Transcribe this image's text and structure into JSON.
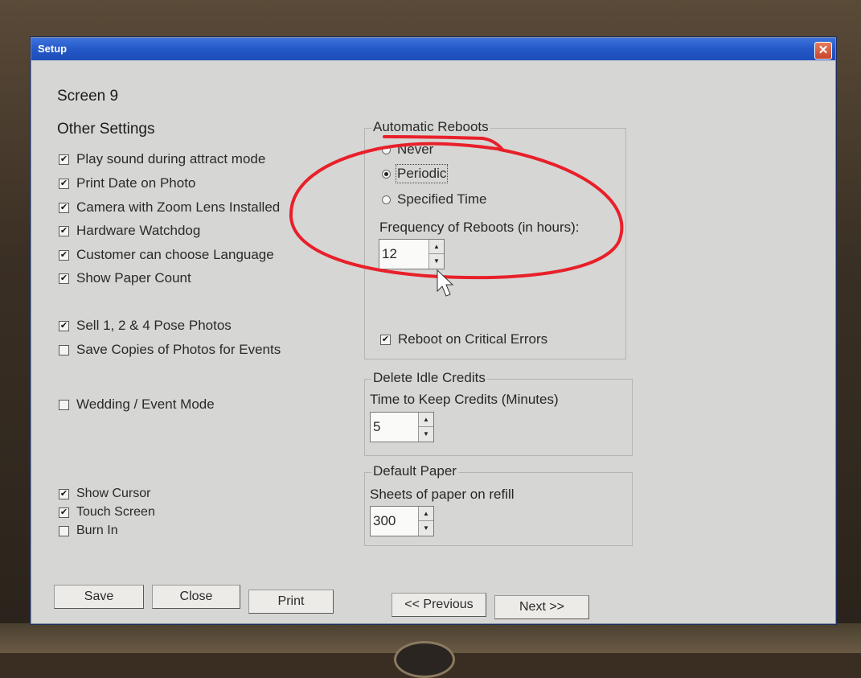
{
  "window": {
    "title": "Setup",
    "close_glyph": "✕"
  },
  "screen_label": "Screen 9",
  "other_settings": {
    "heading": "Other Settings",
    "items": [
      {
        "label": "Play sound during attract mode",
        "checked": true
      },
      {
        "label": "Print Date on Photo",
        "checked": true
      },
      {
        "label": "Camera with Zoom Lens Installed",
        "checked": true
      },
      {
        "label": "Hardware Watchdog",
        "checked": true
      },
      {
        "label": "Customer can choose Language",
        "checked": true
      },
      {
        "label": "Show Paper Count",
        "checked": true
      }
    ],
    "pose_items": [
      {
        "label": "Sell 1, 2 & 4 Pose Photos",
        "checked": true
      },
      {
        "label": "Save Copies of Photos for Events",
        "checked": false
      }
    ],
    "wedding": {
      "label": "Wedding / Event Mode",
      "checked": false
    },
    "bottom_items": [
      {
        "label": "Show Cursor",
        "checked": true
      },
      {
        "label": "Touch Screen",
        "checked": true
      },
      {
        "label": "Burn In",
        "checked": false
      }
    ]
  },
  "automatic_reboots": {
    "legend": "Automatic Reboots",
    "options": [
      {
        "label": "Never",
        "selected": false
      },
      {
        "label": "Periodic",
        "selected": true
      },
      {
        "label": "Specified Time",
        "selected": false
      }
    ],
    "frequency_label": "Frequency of Reboots (in hours):",
    "frequency_value": "12",
    "critical_errors": {
      "label": "Reboot on Critical Errors",
      "checked": true
    }
  },
  "delete_idle_credits": {
    "legend": "Delete Idle Credits",
    "label": "Time to Keep Credits (Minutes)",
    "value": "5"
  },
  "default_paper": {
    "legend": "Default Paper",
    "label": "Sheets of paper on refill",
    "value": "300"
  },
  "buttons": {
    "save": "Save",
    "close": "Close",
    "print": "Print",
    "previous": "<< Previous",
    "next": "Next >>"
  },
  "check_glyph": "✔",
  "spin_up": "▲",
  "spin_down": "▼",
  "colors": {
    "titlebar": "#2458c8",
    "annotation": "#e8202a",
    "dialog_bg": "#d6d6d4"
  }
}
